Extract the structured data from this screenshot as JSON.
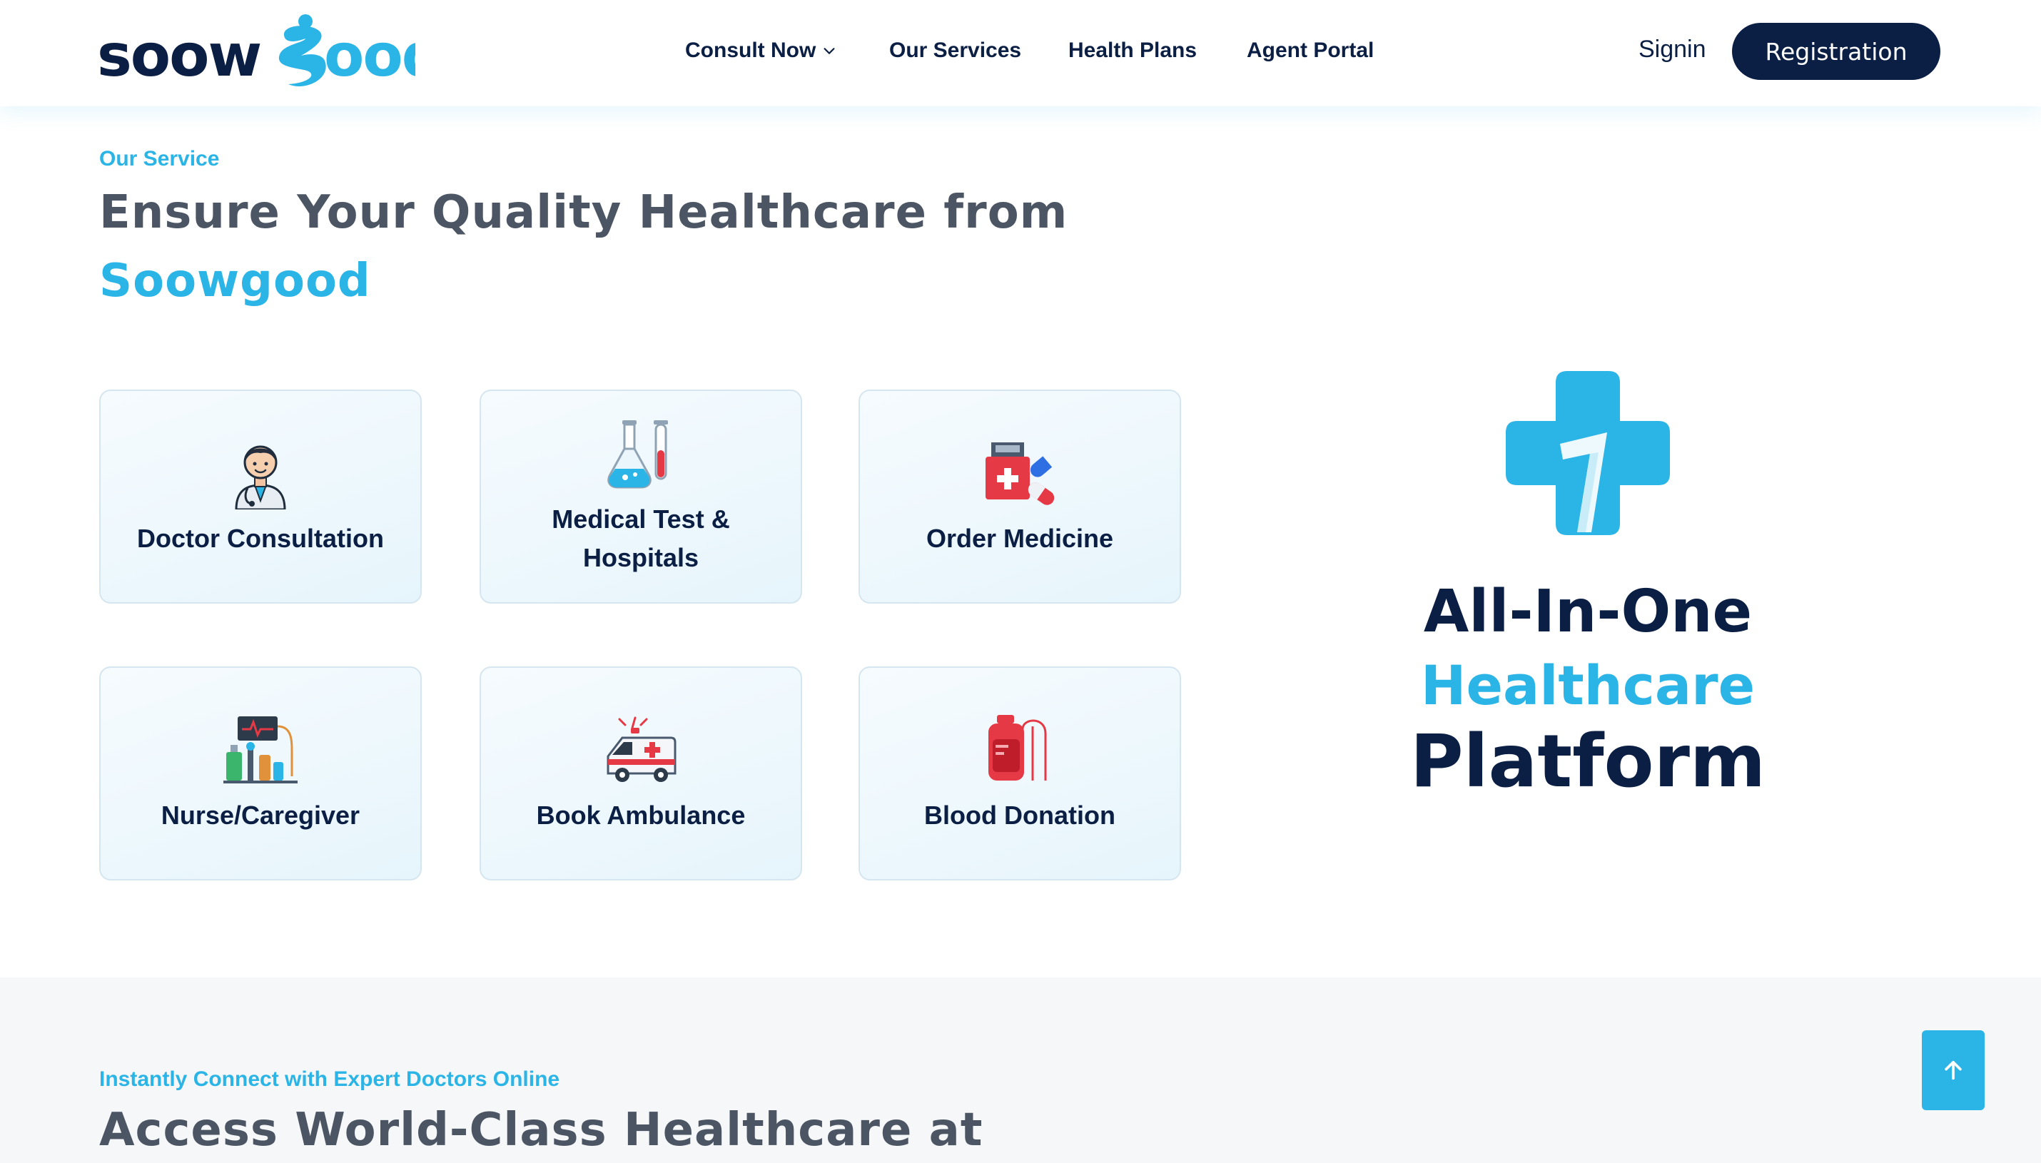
{
  "brand": {
    "logo_text": "soowgood",
    "primary": "#0b1f44",
    "accent": "#2bb4e6"
  },
  "nav": {
    "items": [
      {
        "label": "Consult Now",
        "dropdown": true
      },
      {
        "label": "Our Services"
      },
      {
        "label": "Health Plans"
      },
      {
        "label": "Agent Portal"
      }
    ],
    "signin": "Signin",
    "register": "Registration"
  },
  "services": {
    "eyebrow": "Our Service",
    "headline": "Ensure Your Quality Healthcare from",
    "headline_accent": "Soowgood",
    "cards": [
      {
        "label": "Doctor Consultation",
        "icon": "doctor-icon"
      },
      {
        "label": "Medical Test & Hospitals",
        "icon": "lab-flask-icon"
      },
      {
        "label": "Order Medicine",
        "icon": "medicine-icon"
      },
      {
        "label": "Nurse/Caregiver",
        "icon": "nurse-equipment-icon"
      },
      {
        "label": "Book Ambulance",
        "icon": "ambulance-icon"
      },
      {
        "label": "Blood Donation",
        "icon": "blood-bag-icon"
      }
    ]
  },
  "promo": {
    "line1": "All-In-One",
    "line2": "Healthcare",
    "line3": "Platform",
    "icon": "medical-cross-icon"
  },
  "connect": {
    "eyebrow": "Instantly Connect with Expert Doctors Online",
    "headline": "Access World-Class Healthcare at"
  },
  "scroll_top": {
    "icon": "arrow-up-icon"
  }
}
